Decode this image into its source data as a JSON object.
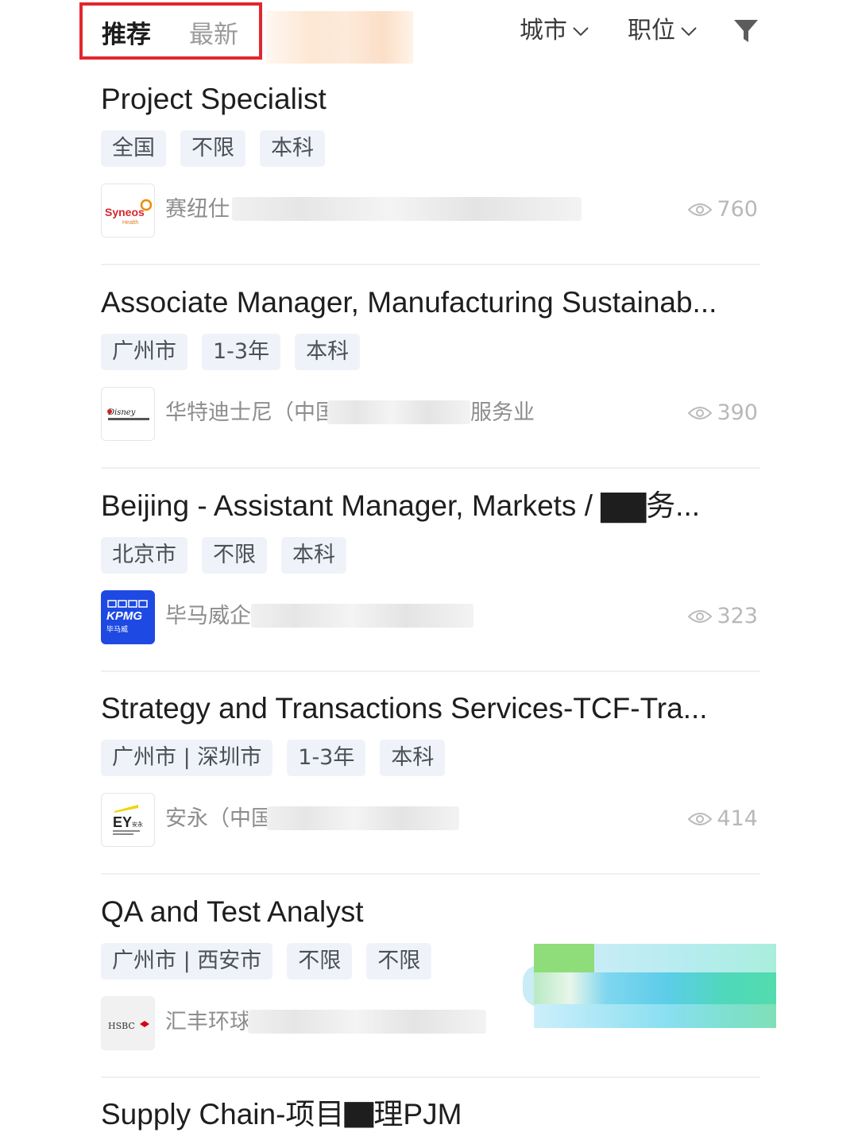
{
  "header": {
    "tab_recommended": "推荐",
    "tab_latest": "最新",
    "filter_city": "城市",
    "filter_position": "职位"
  },
  "jobs": [
    {
      "title": "Project Specialist",
      "tags": [
        "全国",
        "不限",
        "本科"
      ],
      "company": "赛纽仕",
      "logo_text": "Syneos",
      "logo_sub": "Health",
      "views": "760"
    },
    {
      "title": "Associate Manager, Manufacturing Sustainab...",
      "tags": [
        "广州市",
        "1-3年",
        "本科"
      ],
      "company": "华特迪士尼（中国",
      "company_suffix": "服务业",
      "logo_text": "Disney",
      "views": "390"
    },
    {
      "title": "Beijing - Assistant Manager, Markets / ▇▇务...",
      "tags": [
        "北京市",
        "不限",
        "本科"
      ],
      "company": "毕马威企",
      "logo_text": "KPMG",
      "logo_sub": "毕马威",
      "views": "323"
    },
    {
      "title": "Strategy and Transactions Services-TCF-Tra...",
      "tags": [
        "广州市 | 深圳市",
        "1-3年",
        "本科"
      ],
      "company": "安永（中国",
      "logo_text": "EY",
      "logo_sub": "安永",
      "views": "414"
    },
    {
      "title": "QA and Test Analyst",
      "tags": [
        "广州市 | 西安市",
        "不限",
        "不限"
      ],
      "company": "汇丰环球",
      "logo_text": "HSBC",
      "views": ""
    },
    {
      "title": "Supply Chain-项目▇理PJM",
      "tags": [],
      "company": "",
      "views": ""
    }
  ]
}
